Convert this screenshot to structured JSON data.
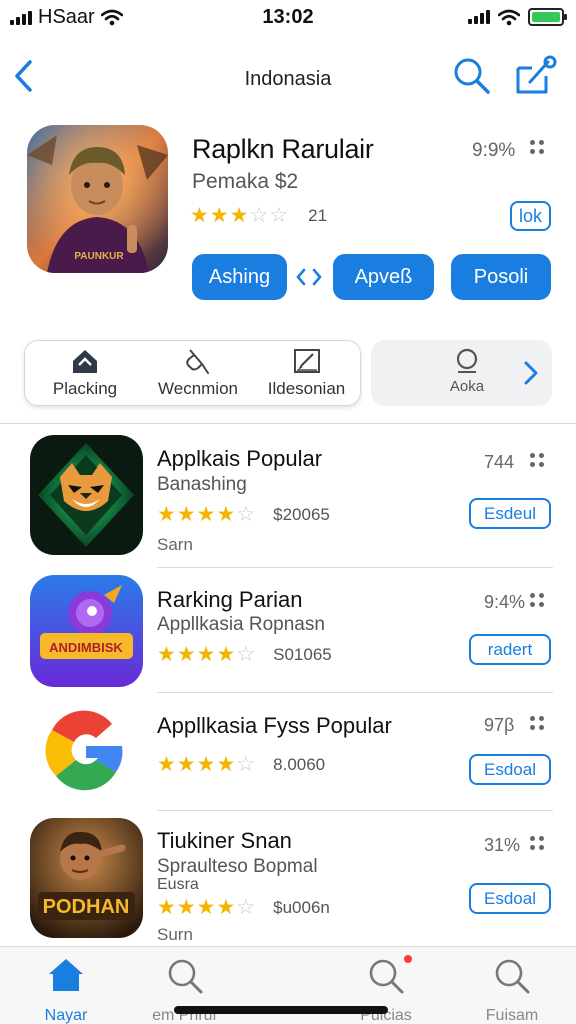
{
  "status_bar": {
    "carrier": "HSaar",
    "time": "13:02"
  },
  "nav": {
    "title": "Indonasia",
    "back_icon": "chevron-left-icon",
    "search_icon": "search-icon",
    "share_icon": "share-icon"
  },
  "hero": {
    "name": "Raplkn Rarulair",
    "subtitle": "Pemaka  $2",
    "rating": 3.5,
    "rating_count": "21",
    "percent": "9:9%",
    "open_label": "lok",
    "buttons": {
      "left": "Ashing",
      "middle": "Apveß",
      "right": "Posoli"
    },
    "accent": "#1a7ee0"
  },
  "segment": {
    "items": [
      {
        "label": "Placking",
        "icon": "home-icon"
      },
      {
        "label": "Wecnmion",
        "icon": "tag-icon"
      },
      {
        "label": "Ildesonian",
        "icon": "edit-icon"
      }
    ],
    "more_label": "Aoka",
    "more_icon": "search-icon"
  },
  "list": [
    {
      "name": "Applkais Popular",
      "sub": "Banashing",
      "extra": "Sarn",
      "rating": 4.5,
      "price": "$20065",
      "percent": "744",
      "button": "Esdeul"
    },
    {
      "name": "Rarking Parian",
      "sub": "Appllkasia Ropnasn",
      "extra": "",
      "rating": 4.5,
      "price": "S01065",
      "percent": "9:4%",
      "button": "radert"
    },
    {
      "name": "Appllkasia Fyss Popular",
      "sub": "",
      "extra": "",
      "rating": 4.5,
      "price": "8.0060",
      "percent": "97β",
      "button": "Esdoal"
    },
    {
      "name": "Tiukiner Snan",
      "sub": "Spraulteso Bopmal",
      "sub2": "Eusra",
      "extra": "Surn",
      "rating": 4.5,
      "price": "$u006n",
      "percent": "31%",
      "button": "Esdoal"
    }
  ],
  "tabbar": [
    {
      "label": "Nayar",
      "icon": "home-icon",
      "active": true
    },
    {
      "label": "em Prirur",
      "icon": "search-icon",
      "active": false
    },
    {
      "label": "Pulcias",
      "icon": "search-icon",
      "active": false,
      "badge": true
    },
    {
      "label": "Fuisam",
      "icon": "search-icon",
      "active": false
    }
  ],
  "icon_texts": {
    "game1": "PAUNKUR",
    "game2": "ANDIMBISK",
    "game4": "PODHAN"
  }
}
